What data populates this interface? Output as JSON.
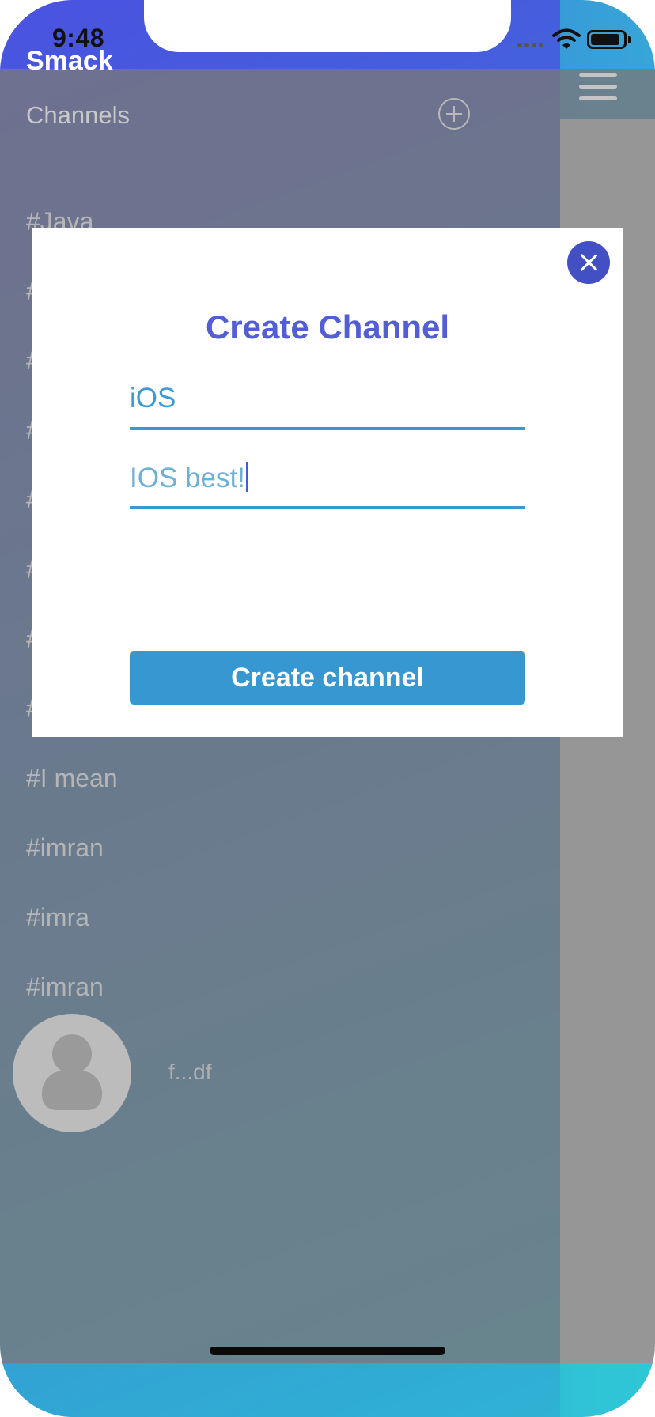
{
  "status_bar": {
    "time": "9:48"
  },
  "app": {
    "title": "Smack"
  },
  "menu": {
    "section_title": "Channels",
    "channels": [
      "#Java",
      "#",
      "#",
      "#",
      "#",
      "#",
      "#",
      "#",
      "#I mean",
      "#imran",
      "#imra",
      "#imran"
    ],
    "user_name": "f...df"
  },
  "modal": {
    "title": "Create Channel",
    "channel_name_value": "iOS",
    "channel_description_value": "IOS best!",
    "create_button_label": "Create channel"
  },
  "colors": {
    "accent": "#535dd6",
    "button": "#3798d1",
    "close_button": "#4350c4"
  }
}
